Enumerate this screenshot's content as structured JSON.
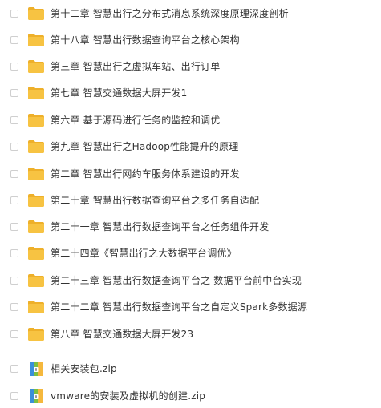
{
  "file_list": {
    "items": [
      {
        "name": "第十二章 智慧出行之分布式消息系统深度原理深度剖析",
        "type": "folder",
        "icon": "folder-icon"
      },
      {
        "name": "第十八章 智慧出行数据查询平台之核心架构",
        "type": "folder",
        "icon": "folder-icon"
      },
      {
        "name": "第三章 智慧出行之虚拟车站、出行订单",
        "type": "folder",
        "icon": "folder-icon"
      },
      {
        "name": "第七章 智慧交通数据大屏开发1",
        "type": "folder",
        "icon": "folder-icon"
      },
      {
        "name": "第六章 基于源码进行任务的监控和调优",
        "type": "folder",
        "icon": "folder-icon"
      },
      {
        "name": "第九章 智慧出行之Hadoop性能提升的原理",
        "type": "folder",
        "icon": "folder-icon"
      },
      {
        "name": "第二章 智慧出行网约车服务体系建设的开发",
        "type": "folder",
        "icon": "folder-icon"
      },
      {
        "name": "第二十章 智慧出行数据查询平台之多任务自适配",
        "type": "folder",
        "icon": "folder-icon"
      },
      {
        "name": "第二十一章 智慧出行数据查询平台之任务组件开发",
        "type": "folder",
        "icon": "folder-icon"
      },
      {
        "name": "第二十四章《智慧出行之大数据平台调优》",
        "type": "folder",
        "icon": "folder-icon"
      },
      {
        "name": "第二十三章 智慧出行数据查询平台之 数据平台前中台实现",
        "type": "folder",
        "icon": "folder-icon"
      },
      {
        "name": "第二十二章 智慧出行数据查询平台之自定义Spark多数据源",
        "type": "folder",
        "icon": "folder-icon"
      },
      {
        "name": "第八章 智慧交通数据大屏开发23",
        "type": "folder",
        "icon": "folder-icon"
      },
      {
        "name": "相关安装包.zip",
        "type": "zip",
        "icon": "zip-archive-icon"
      },
      {
        "name": "vmware的安装及虚拟机的创建.zip",
        "type": "zip",
        "icon": "zip-archive-icon"
      }
    ]
  },
  "colors": {
    "folder": "#f7c342",
    "folder_tab": "#eeb02a",
    "text": "#333333",
    "checkbox_border": "#cfcfcf"
  }
}
